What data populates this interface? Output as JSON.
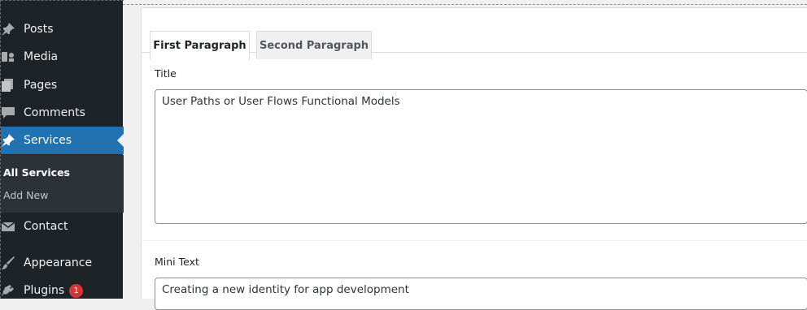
{
  "sidebar": {
    "items": [
      {
        "label": "Posts",
        "icon": "pin-icon"
      },
      {
        "label": "Media",
        "icon": "media-icon"
      },
      {
        "label": "Pages",
        "icon": "pages-icon"
      },
      {
        "label": "Comments",
        "icon": "comment-icon"
      },
      {
        "label": "Services",
        "icon": "pin-icon",
        "active": true
      },
      {
        "label": "Contact",
        "icon": "mail-icon"
      },
      {
        "label": "Appearance",
        "icon": "brush-icon"
      },
      {
        "label": "Plugins",
        "icon": "plug-icon",
        "badge": "1"
      }
    ],
    "submenu": [
      {
        "label": "All Services",
        "current": true
      },
      {
        "label": "Add New"
      }
    ]
  },
  "tabs": [
    {
      "label": "First Paragraph",
      "active": true
    },
    {
      "label": "Second Paragraph"
    }
  ],
  "fields": {
    "title": {
      "label": "Title",
      "value": "User Paths or User Flows Functional Models"
    },
    "mini_text": {
      "label": "Mini Text",
      "value": "Creating a new identity for app development"
    }
  },
  "colors": {
    "sidebar_bg": "#1d2327",
    "active_bg": "#2271b1",
    "badge_bg": "#d63638"
  }
}
